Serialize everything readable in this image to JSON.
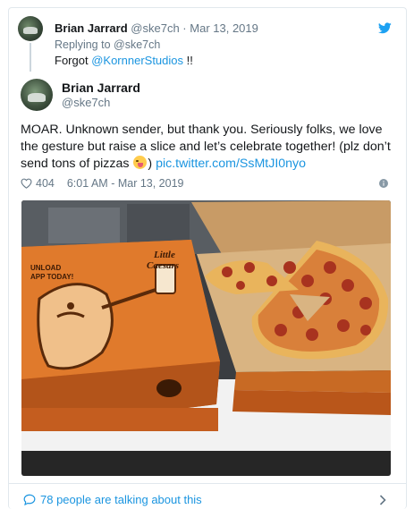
{
  "colors": {
    "link": "#1b95e0",
    "secondary_text": "#657786",
    "primary_text": "#14171a",
    "border": "#e1e8ed"
  },
  "parent_tweet": {
    "author_name": "Brian Jarrard",
    "author_handle": "@ske7ch",
    "separator": "·",
    "date": "Mar 13, 2019",
    "replying_label": "Replying to",
    "replying_to": "@ske7ch",
    "text_prefix": "Forgot",
    "text_mention": "@KornnerStudios",
    "text_suffix": "!!"
  },
  "main_tweet": {
    "author_name": "Brian Jarrard",
    "author_handle": "@ske7ch",
    "text": "MOAR. Unknown sender, but thank you. Seriously folks, we love the gesture but raise a slice and let’s celebrate together! (plz don’t send tons of pizzas",
    "text_after_emoji": ")",
    "emoji": "squinting-face-with-tongue",
    "link": "pic.twitter.com/SsMtJI0nyo",
    "likes": "404",
    "time": "6:01 AM - Mar 13, 2019"
  },
  "photo": {
    "box_brand_line1": "Little",
    "box_brand_line2": "Caesars",
    "box_headline_line1": "UNLOAD",
    "box_headline_line2": "APP TODAY!"
  },
  "footer": {
    "talking_text": "78 people are talking about this"
  },
  "icons": {
    "brand": "twitter-bird-icon",
    "like": "heart-icon",
    "info": "info-icon",
    "reply": "speech-bubble-icon",
    "more": "chevron-right-icon"
  }
}
